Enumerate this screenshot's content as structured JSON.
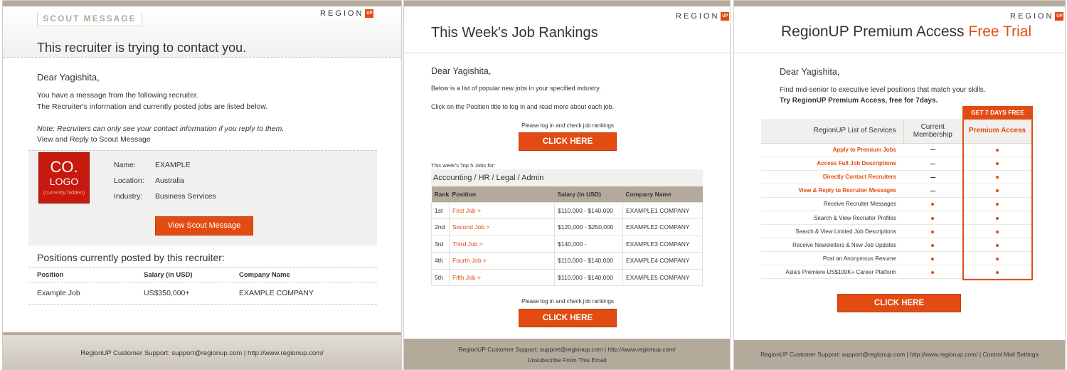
{
  "brand": {
    "logo_text": "REGION",
    "logo_badge": "UP",
    "accent": "#e24c12",
    "footer_bg": "#b4aa9b"
  },
  "panel1": {
    "tag": "SCOUT MESSAGE",
    "title": "This recruiter is trying to contact you.",
    "greeting": "Dear Yagishita,",
    "line1": "You have a message from the following recruiter.",
    "line2": "The Recruiter's information and currently posted jobs are listed below.",
    "note": "Note: Recruiters can only see your contact information if you reply to them.",
    "reply_link": "View and Reply to Scout Message",
    "logo": {
      "line1": "CO.",
      "line2": "LOGO",
      "line3": "(currently hidden)"
    },
    "fields": [
      {
        "label": "Name:",
        "value": "EXAMPLE"
      },
      {
        "label": "Location:",
        "value": "Australia"
      },
      {
        "label": "Industry:",
        "value": "Business Services"
      }
    ],
    "view_button": "View Scout Message",
    "positions_heading": "Positions currently posted by this recruiter:",
    "table_headers": [
      "Position",
      "Salary (in USD)",
      "Company Name"
    ],
    "rows": [
      [
        "Example Job",
        "US$350,000+",
        "EXAMPLE COMPANY"
      ]
    ],
    "footer": "RegionUP Customer Support:   support@regionup.com   |   http://www.regionup.com/"
  },
  "panel2": {
    "title": "This Week's Job Rankings",
    "greeting": "Dear Yagishita,",
    "line1": "Below is a list of popular new jobs in your specified industry.",
    "line2": "Click on the Position title to log in and read more about each job.",
    "login_prompt": "Please log in and check job rankings",
    "click_here": "CLICK HERE",
    "top5_label": "This week's Top 5 Jobs for:",
    "category": "Accounting / HR / Legal / Admin",
    "headers": [
      "Rank",
      "Position",
      "Salary (in USD)",
      "Company Name"
    ],
    "rows": [
      [
        "1st",
        "First Job >",
        "$110,000 - $140,000",
        "EXAMPLE1 COMPANY"
      ],
      [
        "2nd",
        "Second Job >",
        "$120,000 - $250,000",
        "EXAMPLE2 COMPANY"
      ],
      [
        "3rd",
        "Third Job >",
        "$140,000 -",
        "EXAMPLE3 COMPANY"
      ],
      [
        "4th",
        "Fourth Job >",
        "$110,000 - $140,000",
        "EXAMPLE4 COMPANY"
      ],
      [
        "5th",
        "Fifth Job >",
        "$110,000 - $140,000",
        "EXAMPLE5 COMPANY"
      ]
    ],
    "footer_line1": "RegionUP Customer Support:   support@regionup.com   |   http://www.regionup.com/",
    "footer_line2": "Unsubscribe From This Email"
  },
  "panel3": {
    "title_main": "RegionUP Premium Access ",
    "title_accent": "Free Trial",
    "greeting": "Dear Yagishita,",
    "line1": "Find mid-senior to executive level positions that match your skills.",
    "line2": "Try RegionUP Premium Access, free for 7days.",
    "promo_tag": "GET 7 DAYS FREE",
    "col_services": "RegionUP List of Services",
    "col_current": "Current Membership",
    "col_premium": "Premium Access",
    "services": [
      {
        "name": "Apply to Premium Jobs",
        "highlight": true,
        "current": "dash",
        "premium": "dot"
      },
      {
        "name": "Access Full Job Descriptions",
        "highlight": true,
        "current": "dash",
        "premium": "dot"
      },
      {
        "name": "Directly Contact Recruiters",
        "highlight": true,
        "current": "dash",
        "premium": "dot"
      },
      {
        "name": "View & Reply to Recruiter Messages",
        "highlight": true,
        "current": "dash",
        "premium": "dot"
      },
      {
        "name": "Receive Recruiter Messages",
        "highlight": false,
        "current": "dot",
        "premium": "dot"
      },
      {
        "name": "Search & View Recruiter Profiles",
        "highlight": false,
        "current": "dot",
        "premium": "dot"
      },
      {
        "name": "Search & View Limited Job Descriptions",
        "highlight": false,
        "current": "dot",
        "premium": "dot"
      },
      {
        "name": "Receive Newsletters & New Job Updates",
        "highlight": false,
        "current": "dot",
        "premium": "dot"
      },
      {
        "name": "Post an Anonymous Resume",
        "highlight": false,
        "current": "dot",
        "premium": "dot"
      },
      {
        "name": "Asia's Premiere US$100K+ Career Platform",
        "highlight": false,
        "current": "dot",
        "premium": "dot"
      }
    ],
    "click_here": "CLICK HERE",
    "footer": "RegionUP Customer Support:   support@regionup.com   |   http://www.regionup.com/   |   Control Mail Settings"
  }
}
